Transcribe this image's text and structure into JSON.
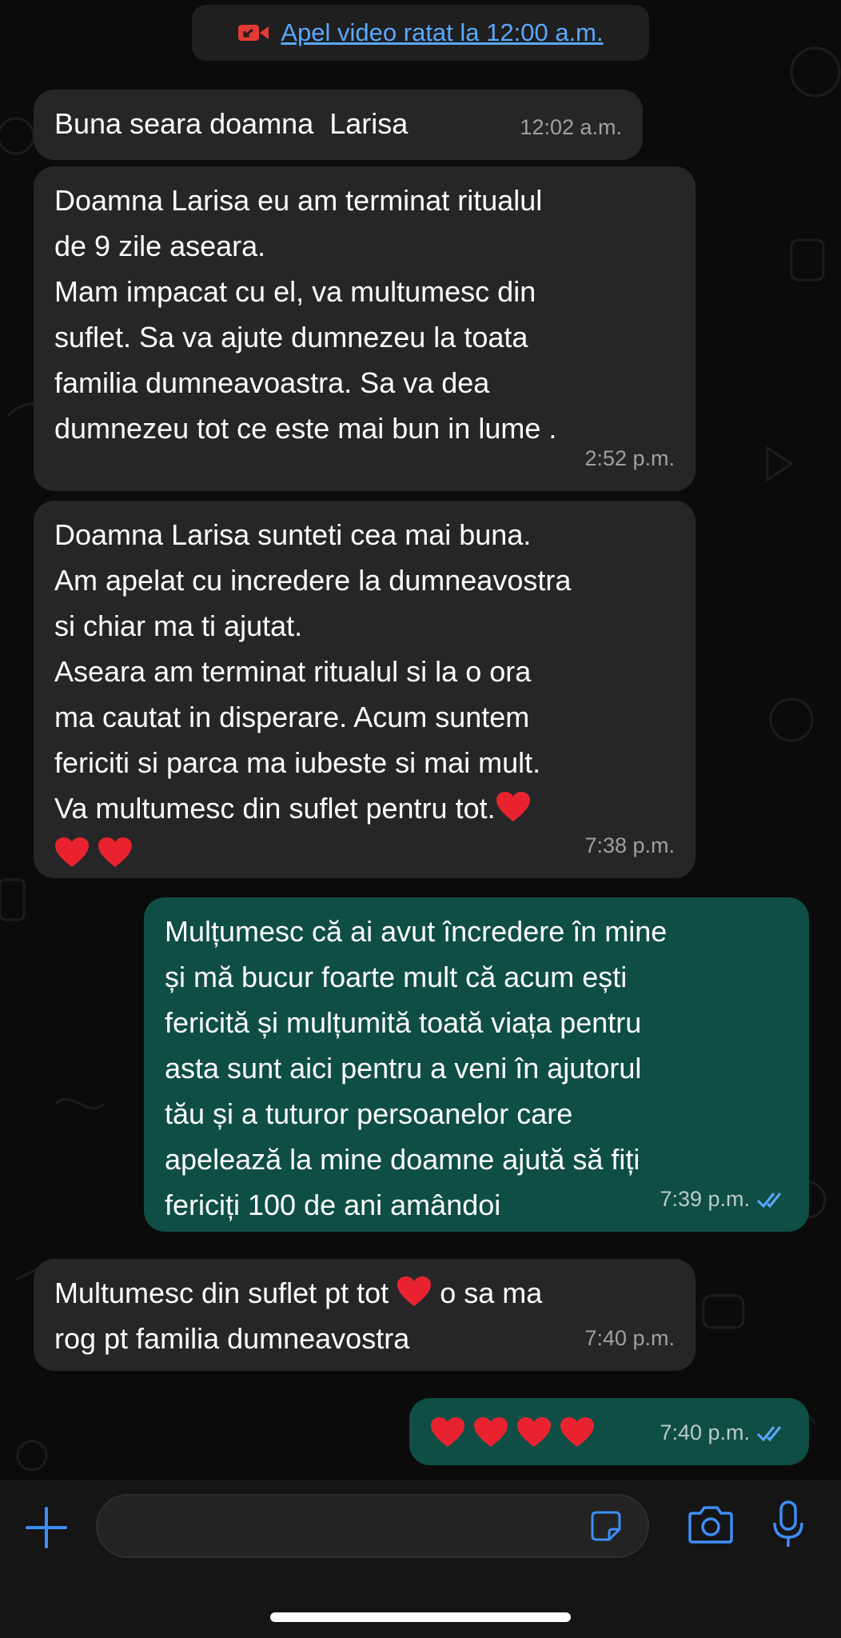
{
  "system_message": {
    "text": "Apel video ratat la 12:00 a.m."
  },
  "messages": [
    {
      "direction": "in",
      "text": "Buna seara doamna  Larisa",
      "time": "12:02 a.m."
    },
    {
      "direction": "in",
      "text": "Doamna Larisa eu am terminat ritualul\nde 9 zile aseara.\nMam impacat cu el, va multumesc din\nsuflet. Sa va ajute dumnezeu la toata\nfamilia dumneavoastra. Sa va dea\ndumnezeu tot ce este mai bun in lume .",
      "time": "2:52 p.m."
    },
    {
      "direction": "in",
      "text": "Doamna Larisa sunteti cea mai buna.\nAm apelat cu incredere la dumneavostra\nsi chiar ma ti ajutat.\nAseara am terminat ritualul si la o ora\nma cautat in disperare. Acum suntem\nfericiti si parca ma iubeste si mai mult.\nVa multumesc din suflet pentru tot.",
      "time": "7:38 p.m.",
      "emoji_count": 3
    },
    {
      "direction": "out",
      "text": "Mulțumesc că ai avut încredere în mine\nși mă bucur foarte mult că acum ești\nfericită și mulțumită toată viața pentru\nasta sunt aici pentru a veni în ajutorul\ntău și a tuturor persoanelor care\napelează la mine doamne ajută să fiți\nfericiți 100 de ani amândoi",
      "time": "7:39 p.m.",
      "read": true
    },
    {
      "direction": "in",
      "text_before": "Multumesc din suflet pt tot",
      "text_after": "o sa ma\nrog pt familia dumneavostra",
      "time": "7:40 p.m.",
      "emoji_count": 1
    },
    {
      "direction": "out",
      "emoji_count": 4,
      "time": "7:40 p.m.",
      "read": true
    }
  ],
  "emoji": "red-heart",
  "composer": {
    "placeholder": ""
  },
  "icons": {
    "attach": "plus-icon",
    "sticker": "sticker-icon",
    "camera": "camera-icon",
    "mic": "microphone-icon",
    "missed_call": "missed-video-call-icon",
    "read_receipt": "double-check-icon"
  },
  "colors": {
    "background": "#0b0b0b",
    "incoming_bubble": "#262628",
    "outgoing_bubble": "#0f4e44",
    "accent": "#3d8ef7",
    "link": "#5aa8ff",
    "missed": "#e53935",
    "heart": "#e8232f"
  }
}
